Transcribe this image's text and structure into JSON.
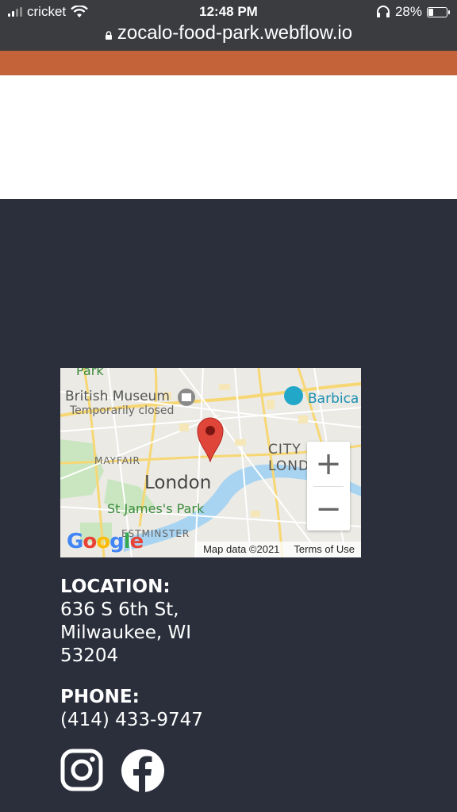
{
  "status_bar": {
    "carrier": "cricket",
    "time": "12:48 PM",
    "battery": "28%",
    "wifi_icon": "wifi-icon",
    "headphones_icon": "headphones-icon"
  },
  "url_bar": {
    "url": "zocalo-food-park.webflow.io",
    "lock_icon": "lock-icon"
  },
  "colors": {
    "accent_band": "#c4623a",
    "footer_bg": "#2a2f3b",
    "chrome_bg": "#3a3c40"
  },
  "map": {
    "labels": {
      "british_museum": "British Museum",
      "temporarily_closed": "Temporarily closed",
      "barbican": "Barbica",
      "mayfair": "MAYFAIR",
      "london": "London",
      "city": "CITY",
      "lond": "LOND",
      "st_james": "St James's Park",
      "westminster": "ESTMINSTER",
      "park": "Park"
    },
    "zoom_in": "+",
    "zoom_out": "−",
    "google_logo": "Google",
    "map_data": "Map data ©2021",
    "terms": "Terms of Use"
  },
  "location": {
    "heading": "LOCATION:",
    "line1": "636 S 6th St,",
    "line2": "Milwaukee, WI",
    "line3": "53204"
  },
  "phone": {
    "heading": "PHONE:",
    "number": "(414) 433-9747"
  },
  "socials": [
    "instagram-icon",
    "facebook-icon"
  ]
}
